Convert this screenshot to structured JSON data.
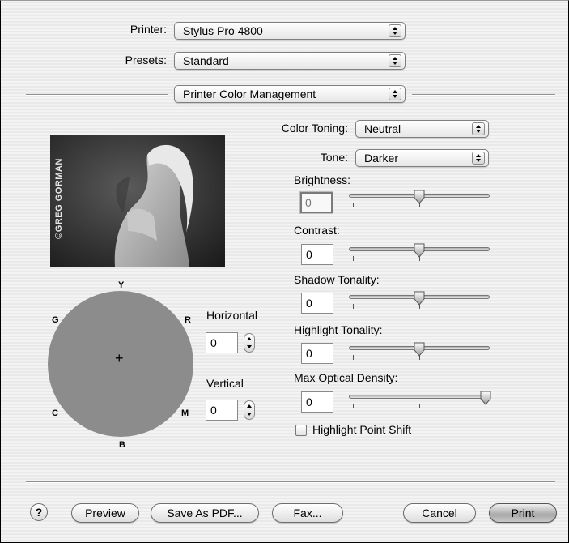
{
  "printer": {
    "label": "Printer:",
    "value": "Stylus Pro 4800"
  },
  "presets": {
    "label": "Presets:",
    "value": "Standard"
  },
  "panel": {
    "value": "Printer Color Management"
  },
  "color_toning": {
    "label": "Color Toning:",
    "value": "Neutral"
  },
  "tone": {
    "label": "Tone:",
    "value": "Darker"
  },
  "brightness": {
    "label": "Brightness:",
    "value": "0",
    "level": 0.5
  },
  "contrast": {
    "label": "Contrast:",
    "value": "0",
    "level": 0.5
  },
  "shadow_tonality": {
    "label": "Shadow Tonality:",
    "value": "0",
    "level": 0.5
  },
  "highlight_tonality": {
    "label": "Highlight Tonality:",
    "value": "0",
    "level": 0.5
  },
  "max_optical_density": {
    "label": "Max Optical Density:",
    "value": "0",
    "level": 1.0
  },
  "highlight_point_shift": {
    "label": "Highlight Point Shift",
    "checked": false
  },
  "photo": {
    "credit": "©GREG GORMAN"
  },
  "color_wheel": {
    "labels": {
      "top": "Y",
      "top_left": "G",
      "top_right": "R",
      "bottom_left": "C",
      "bottom_right": "M",
      "bottom": "B"
    },
    "fill": "#8c8c8c"
  },
  "horizontal": {
    "label": "Horizontal",
    "value": "0"
  },
  "vertical": {
    "label": "Vertical",
    "value": "0"
  },
  "buttons": {
    "help": "?",
    "preview": "Preview",
    "save_pdf": "Save As PDF...",
    "fax": "Fax...",
    "cancel": "Cancel",
    "print": "Print"
  }
}
